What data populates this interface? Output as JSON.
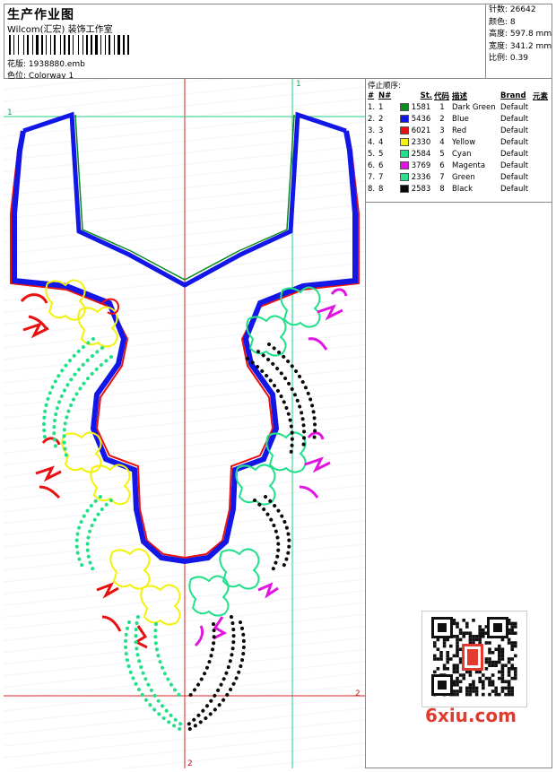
{
  "header": {
    "title": "生产作业图",
    "studio": "Wilcom(汇宏) 装饰工作室",
    "file_label": "花版:",
    "file_value": "1938880.emb",
    "color_label": "色位:",
    "color_value": "Colorway 1"
  },
  "stats": [
    {
      "label": "针数:",
      "value": "26642"
    },
    {
      "label": "颜色:",
      "value": "8"
    },
    {
      "label": "高度:",
      "value": "597.8 mm"
    },
    {
      "label": "宽度:",
      "value": "341.2 mm"
    },
    {
      "label": "比例:",
      "value": "0.39"
    }
  ],
  "stop_sequence": {
    "title": "停止顺序:",
    "headers": [
      "#",
      "N#",
      "St.",
      "代码",
      "描述",
      "Brand",
      "元素"
    ],
    "rows": [
      {
        "num": "1.",
        "n": "1",
        "st": "1581",
        "code": "1",
        "desc": "Dark Green",
        "brand": "Default",
        "color": "#0b8a1e"
      },
      {
        "num": "2.",
        "n": "2",
        "st": "5436",
        "code": "2",
        "desc": "Blue",
        "brand": "Default",
        "color": "#1216e6"
      },
      {
        "num": "3.",
        "n": "3",
        "st": "6021",
        "code": "3",
        "desc": "Red",
        "brand": "Default",
        "color": "#e81010"
      },
      {
        "num": "4.",
        "n": "4",
        "st": "2330",
        "code": "4",
        "desc": "Yellow",
        "brand": "Default",
        "color": "#f2f20a"
      },
      {
        "num": "5.",
        "n": "5",
        "st": "2584",
        "code": "5",
        "desc": "Cyan",
        "brand": "Default",
        "color": "#22e08a"
      },
      {
        "num": "6.",
        "n": "6",
        "st": "3769",
        "code": "6",
        "desc": "Magenta",
        "brand": "Default",
        "color": "#e015e0"
      },
      {
        "num": "7.",
        "n": "7",
        "st": "2336",
        "code": "7",
        "desc": "Green",
        "brand": "Default",
        "color": "#2be08a"
      },
      {
        "num": "8.",
        "n": "8",
        "st": "2583",
        "code": "8",
        "desc": "Black",
        "brand": "Default",
        "color": "#0a0a0a"
      }
    ]
  },
  "guides": {
    "one": "1",
    "two": "2"
  },
  "watermark": "6xiu.com"
}
